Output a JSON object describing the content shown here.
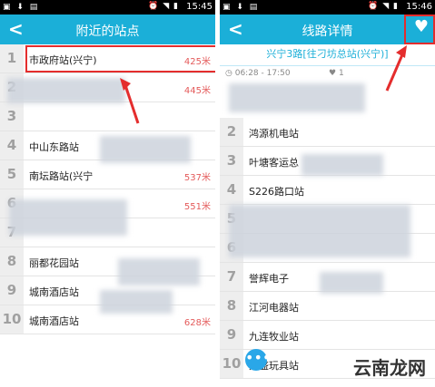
{
  "left_screen": {
    "status_time": "15:45",
    "title": "附近的站点",
    "stations": [
      {
        "num": "1",
        "name": "市政府站(兴宁)",
        "dist": "425米"
      },
      {
        "num": "2",
        "name": "",
        "dist": "445米"
      },
      {
        "num": "3",
        "name": "",
        "dist": ""
      },
      {
        "num": "4",
        "name": "中山东路站",
        "dist": ""
      },
      {
        "num": "5",
        "name": "南坛路站(兴宁",
        "dist": "537米"
      },
      {
        "num": "6",
        "name": "",
        "dist": "551米"
      },
      {
        "num": "7",
        "name": "",
        "dist": ""
      },
      {
        "num": "8",
        "name": "丽都花园站",
        "dist": ""
      },
      {
        "num": "9",
        "name": "城南酒店站",
        "dist": ""
      },
      {
        "num": "10",
        "name": "城南酒店站",
        "dist": "628米"
      }
    ]
  },
  "right_screen": {
    "status_time": "15:46",
    "title": "线路详情",
    "route_name": "兴宁3路[往刁坊总站(兴宁)]",
    "service_time": "06:28 - 17:50",
    "count": "1",
    "stops": [
      {
        "num": "2",
        "name": "鸿源机电站"
      },
      {
        "num": "3",
        "name": "叶塘客运总"
      },
      {
        "num": "4",
        "name": "S226路口站"
      },
      {
        "num": "5",
        "name": ""
      },
      {
        "num": "6",
        "name": ""
      },
      {
        "num": "7",
        "name": "誉辉电子"
      },
      {
        "num": "8",
        "name": "江河电器站"
      },
      {
        "num": "9",
        "name": "九连牧业站"
      },
      {
        "num": "10",
        "name": "大盛玩具站"
      }
    ],
    "fab_symbol": "•••",
    "watermark": "云南龙网"
  },
  "colors": {
    "accent": "#1bafd8",
    "highlight": "#e42d2d",
    "distance": "#e45a5a"
  },
  "icons": {
    "back": "chevron-left-icon",
    "favorite": "heart-icon",
    "clock": "clock-icon",
    "more": "more-icon"
  }
}
